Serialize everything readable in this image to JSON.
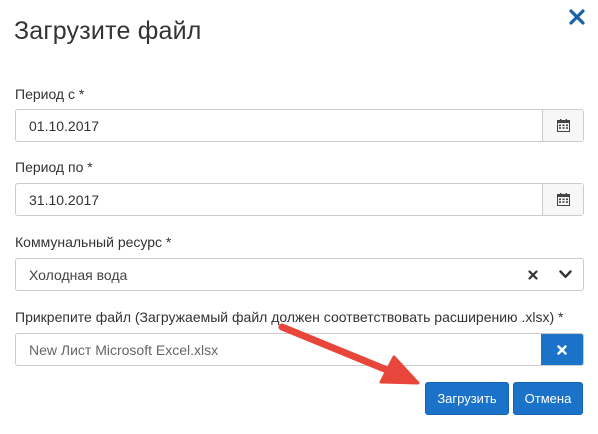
{
  "dialog": {
    "title": "Загрузите файл",
    "close_icon": "close-icon"
  },
  "fields": {
    "period_from": {
      "label": "Период с *",
      "value": "01.10.2017",
      "icon": "calendar-icon"
    },
    "period_to": {
      "label": "Период по *",
      "value": "31.10.2017",
      "icon": "calendar-icon"
    },
    "resource": {
      "label": "Коммунальный ресурс *",
      "value": "Холодная вода",
      "clear_icon": "clear-icon",
      "dropdown_icon": "chevron-down-icon"
    },
    "file": {
      "label": "Прикрепите файл (Загружаемый файл должен соответствовать расширению .xlsx) *",
      "value": "New Лист Microsoft Excel.xlsx",
      "remove_icon": "remove-file-icon"
    }
  },
  "buttons": {
    "upload": "Загрузить",
    "cancel": "Отмена"
  },
  "colors": {
    "primary": "#1a73c8",
    "close": "#1a5fa8",
    "annotation_arrow": "#e8463b",
    "border": "#cccccc"
  },
  "annotation": {
    "type": "arrow",
    "points_to": "upload-button"
  }
}
